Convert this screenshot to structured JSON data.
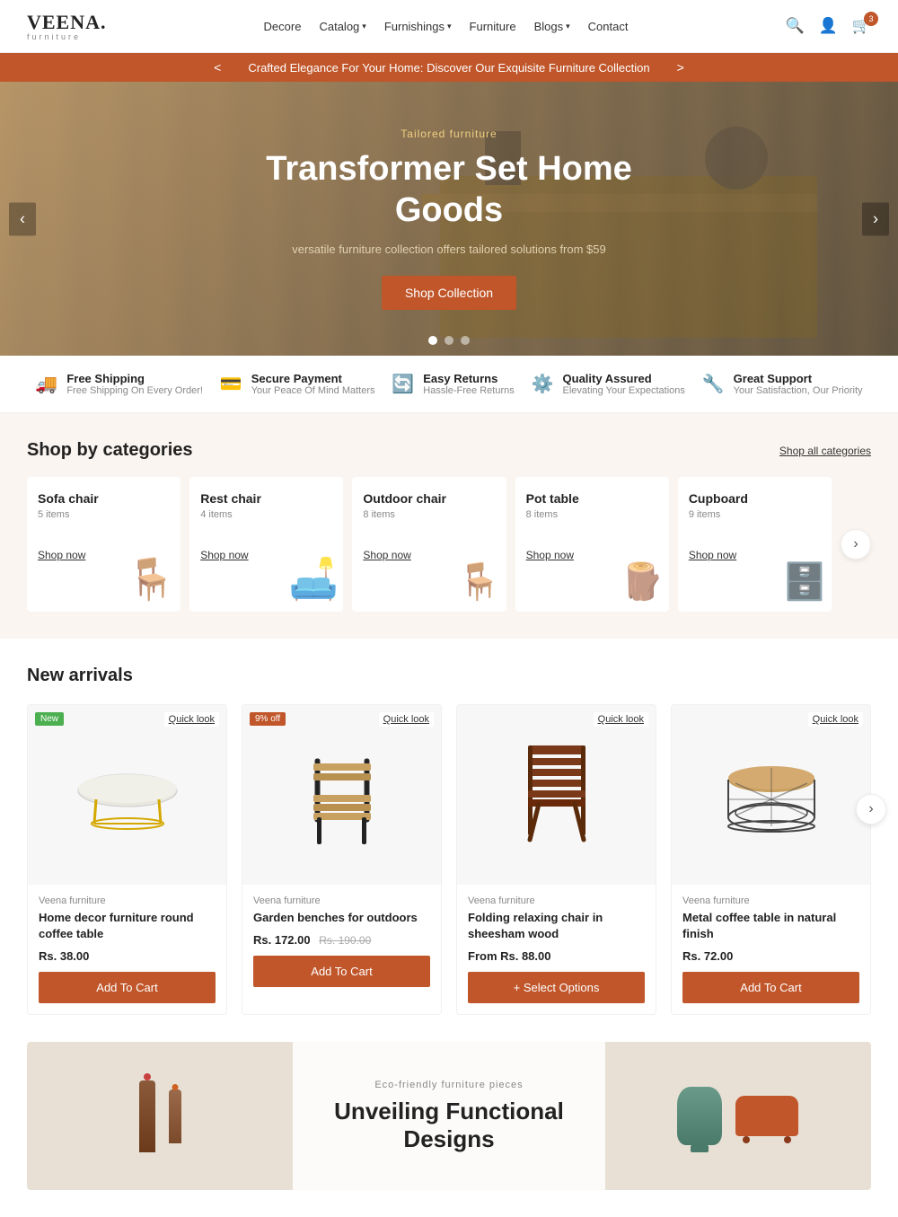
{
  "header": {
    "logo": "VEENA.",
    "logo_sub": "furniture",
    "nav": [
      {
        "label": "Decore",
        "has_dropdown": false
      },
      {
        "label": "Catalog",
        "has_dropdown": true
      },
      {
        "label": "Furnishings",
        "has_dropdown": true
      },
      {
        "label": "Furniture",
        "has_dropdown": false
      },
      {
        "label": "Blogs",
        "has_dropdown": true
      },
      {
        "label": "Contact",
        "has_dropdown": false
      }
    ],
    "cart_count": "3"
  },
  "announce_bar": {
    "text": "Crafted Elegance For Your Home: Discover Our Exquisite Furniture Collection",
    "prev_label": "<",
    "next_label": ">"
  },
  "hero": {
    "subtitle": "Tailored furniture",
    "title": "Transformer Set Home Goods",
    "description": "versatile furniture collection offers tailored solutions from $59",
    "btn_label": "Shop Collection",
    "dots": [
      "active",
      "",
      ""
    ],
    "prev_label": "‹",
    "next_label": "›"
  },
  "features": [
    {
      "icon": "🚚",
      "title": "Free Shipping",
      "desc": "Free Shipping On Every Order!"
    },
    {
      "icon": "💳",
      "title": "Secure Payment",
      "desc": "Your Peace Of Mind Matters"
    },
    {
      "icon": "🔄",
      "title": "Easy Returns",
      "desc": "Hassle-Free Returns"
    },
    {
      "icon": "⚙️",
      "title": "Quality Assured",
      "desc": "Elevating Your Expectations"
    },
    {
      "icon": "🔧",
      "title": "Great Support",
      "desc": "Your Satisfaction, Our Priority"
    }
  ],
  "categories": {
    "section_title": "Shop by categories",
    "shop_all_label": "Shop all categories",
    "items": [
      {
        "name": "Sofa chair",
        "count": "5 items",
        "shop_label": "Shop now",
        "emoji": "🪑"
      },
      {
        "name": "Rest chair",
        "count": "4 items",
        "shop_label": "Shop now",
        "emoji": "🛋️"
      },
      {
        "name": "Outdoor chair",
        "count": "8 items",
        "shop_label": "Shop now",
        "emoji": "🪑"
      },
      {
        "name": "Pot table",
        "count": "8 items",
        "shop_label": "Shop now",
        "emoji": "🪵"
      },
      {
        "name": "Cupboard",
        "count": "9 items",
        "shop_label": "Shop now",
        "emoji": "🗄️"
      }
    ],
    "next_label": "›"
  },
  "new_arrivals": {
    "section_title": "New arrivals",
    "products": [
      {
        "badge": "New",
        "badge_type": "new",
        "quicklook": "Quick look",
        "brand": "Veena furniture",
        "name": "Home decor furniture round coffee table",
        "price": "Rs. 38.00",
        "old_price": null,
        "from_price": false,
        "btn_label": "Add To Cart",
        "btn_type": "add"
      },
      {
        "badge": "9% off",
        "badge_type": "sale",
        "quicklook": "Quick look",
        "brand": "Veena furniture",
        "name": "Garden benches for outdoors",
        "price": "Rs. 172.00",
        "old_price": "Rs. 190.00",
        "from_price": false,
        "btn_label": "Add To Cart",
        "btn_type": "add"
      },
      {
        "badge": null,
        "quicklook": "Quick look",
        "brand": "Veena furniture",
        "name": "Folding relaxing chair in sheesham wood",
        "price": "From Rs. 88.00",
        "old_price": null,
        "from_price": true,
        "btn_label": "+ Select Options",
        "btn_type": "select"
      },
      {
        "badge": null,
        "quicklook": "Quick look",
        "brand": "Veena furniture",
        "name": "Metal coffee table in natural finish",
        "price": "Rs. 72.00",
        "old_price": null,
        "from_price": false,
        "btn_label": "Add To Cart",
        "btn_type": "add"
      }
    ],
    "next_label": "›"
  },
  "bottom_banner": {
    "eco_label": "Eco-friendly furniture pieces",
    "heading": "Unveiling Functional Designs"
  },
  "colors": {
    "accent": "#C0562A",
    "bg_light": "#FAF5F0",
    "text_dark": "#222222"
  }
}
